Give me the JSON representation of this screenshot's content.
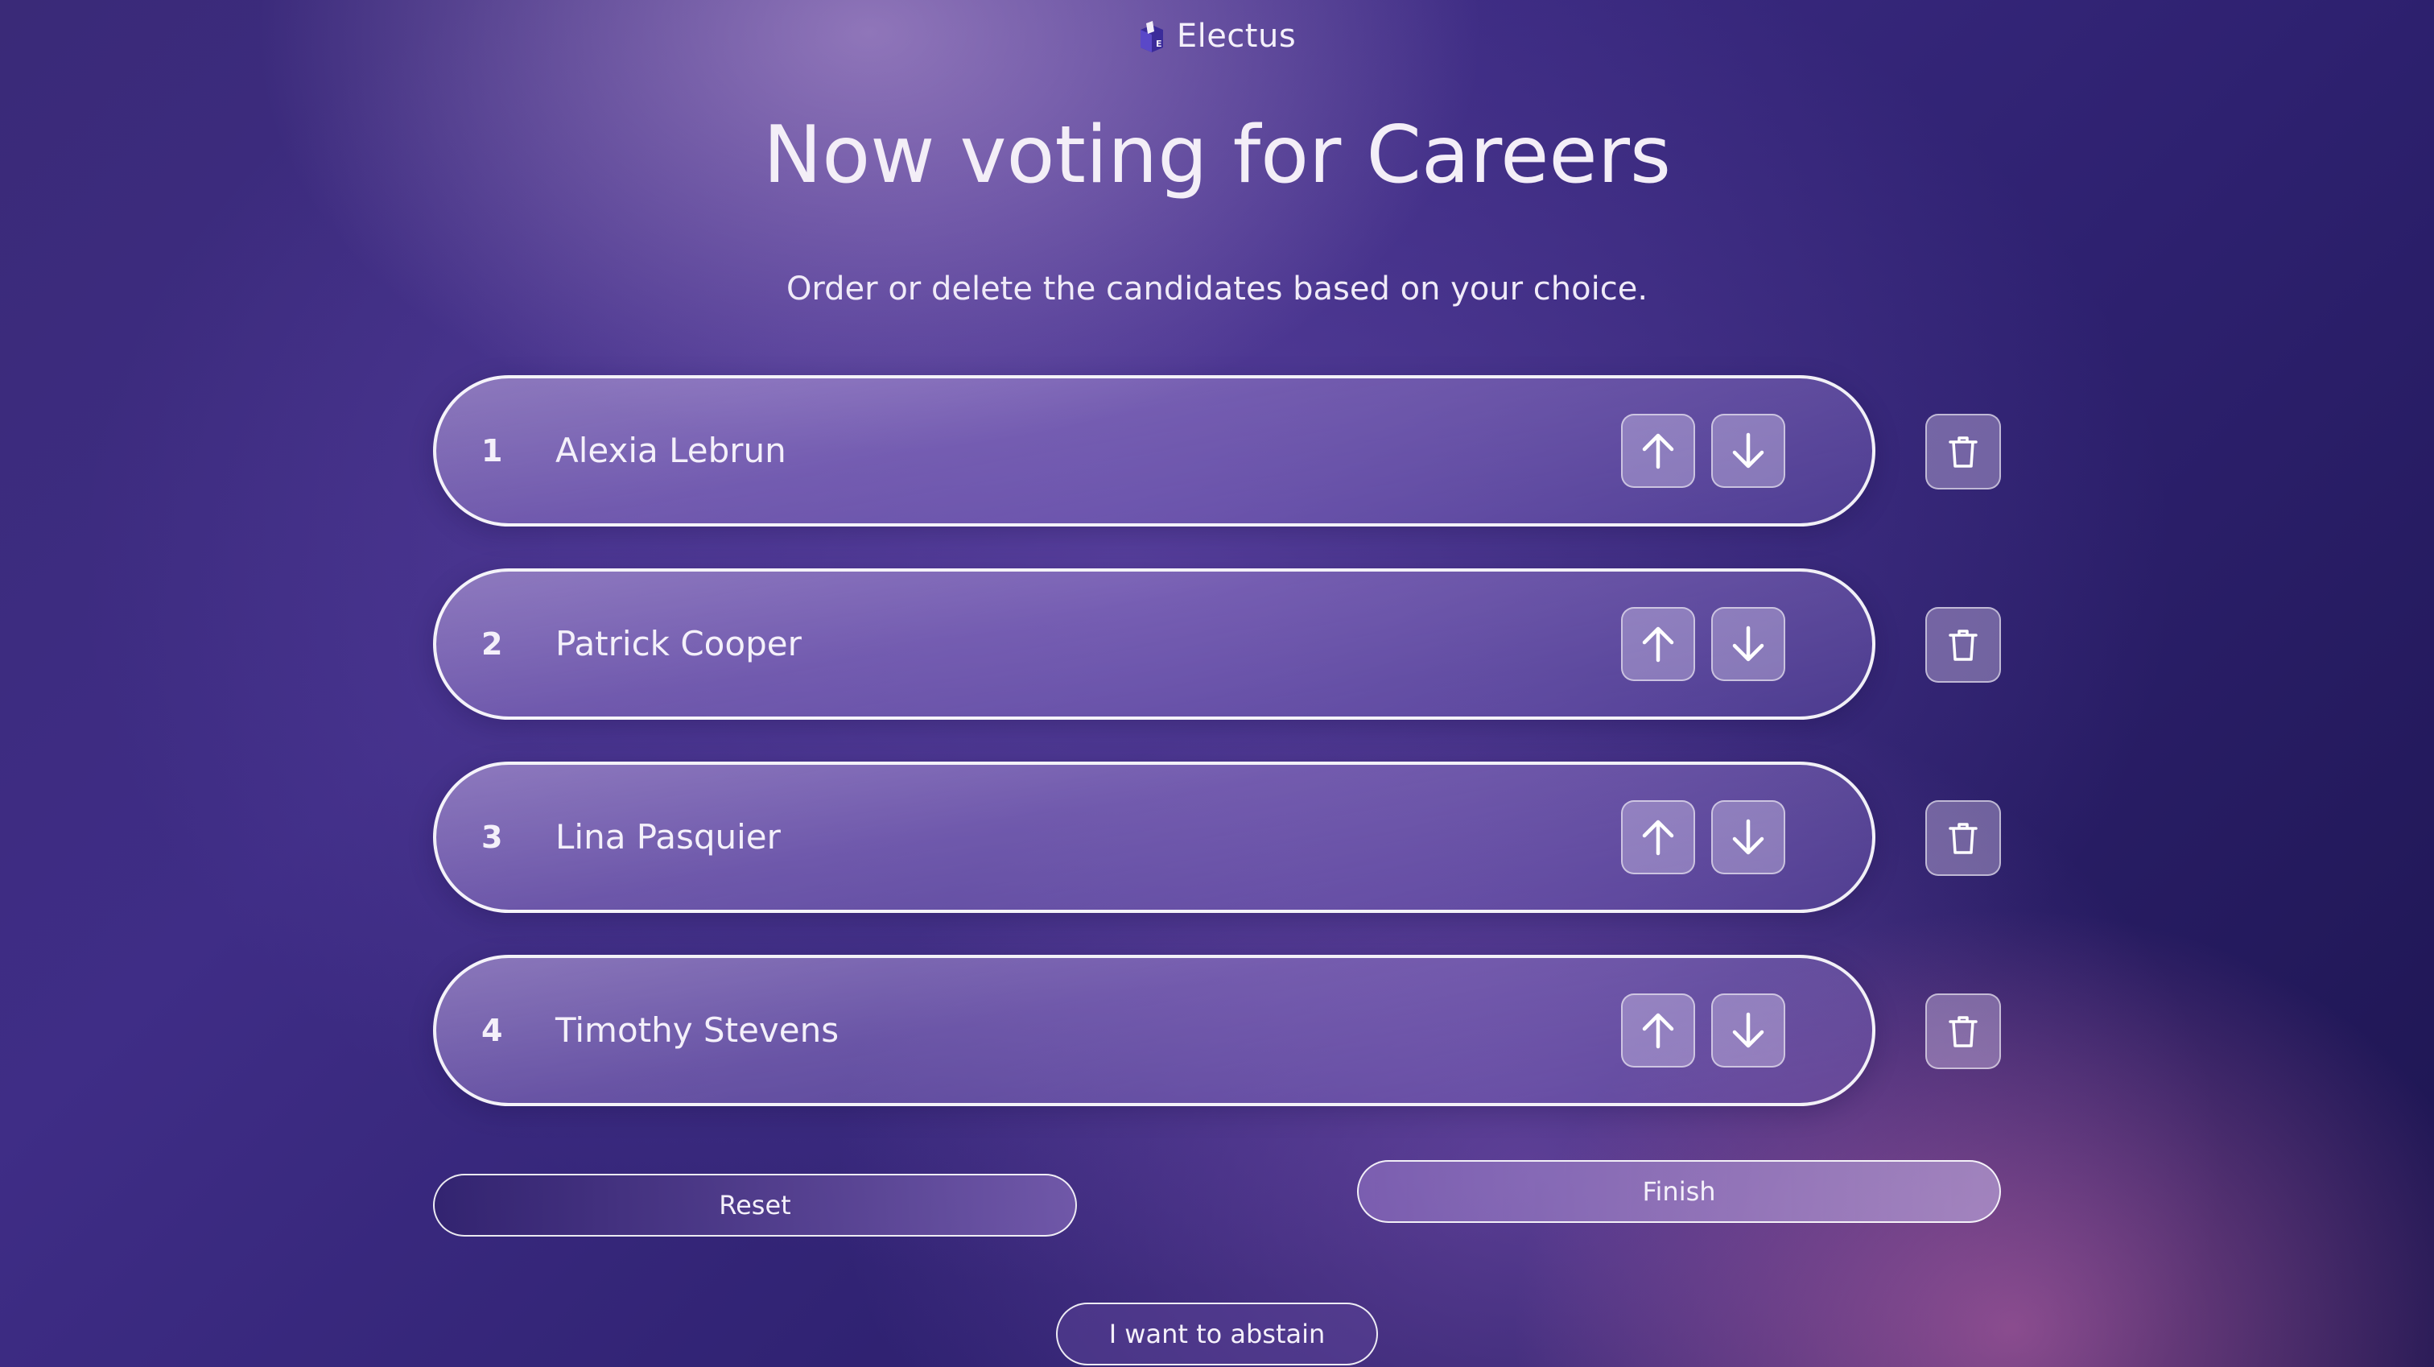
{
  "brand": {
    "name": "Electus",
    "icon": "ballot-box-icon",
    "icon_letter": "E"
  },
  "header": {
    "title": "Now voting for Careers",
    "subtitle": "Order or delete the candidates based on your choice."
  },
  "candidates": [
    {
      "rank": "1",
      "name": "Alexia Lebrun"
    },
    {
      "rank": "2",
      "name": "Patrick Cooper"
    },
    {
      "rank": "3",
      "name": "Lina Pasquier"
    },
    {
      "rank": "4",
      "name": "Timothy Stevens"
    }
  ],
  "icons": {
    "move_up": "arrow-up-icon",
    "move_down": "arrow-down-icon",
    "delete": "trash-icon"
  },
  "actions": {
    "reset_label": "Reset",
    "finish_label": "Finish",
    "abstain_label": "I want to abstain"
  },
  "colors": {
    "background_dark": "#1d1550",
    "background_mid": "#3f2d86",
    "accent_glow": "#d670b0",
    "text": "#f4f0fa"
  }
}
